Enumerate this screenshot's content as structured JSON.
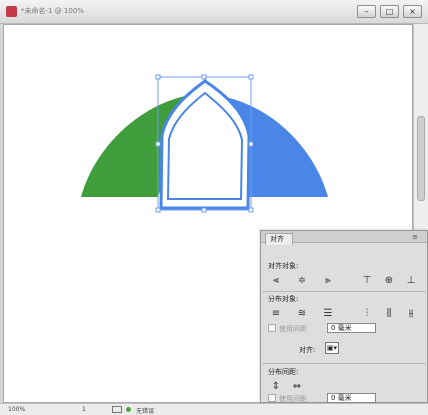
{
  "window": {
    "title": "*未命名-1 @ 100%",
    "minimize_label": "–",
    "restore_label": "□",
    "close_label": "×"
  },
  "status": {
    "zoom": "100%",
    "page": "1",
    "preflight": "无错误"
  },
  "panel": {
    "tab": "对齐",
    "close": "≡",
    "align_objects": "对齐对象:",
    "distribute_objects": "分布对象:",
    "use_spacing_1": "使用间距",
    "spacing_value_1": "0 毫米",
    "align_to_label": "对齐:",
    "distribute_spacing": "分布间距:",
    "use_spacing_2": "使用间距",
    "spacing_value_2": "0 毫米"
  },
  "colors": {
    "green_arc": "#3f9d3b",
    "blue_arc": "#4a86e8",
    "selection_blue": "#5b8fe6",
    "panel_bg": "#dedede"
  },
  "icons": {
    "app": "indesign-icon",
    "window_controls": [
      "minimize-icon",
      "restore-icon",
      "close-icon"
    ],
    "align_row": [
      "align-left-icon",
      "align-horizontal-center-icon",
      "align-right-icon",
      "align-top-icon",
      "align-vertical-center-icon",
      "align-bottom-icon"
    ],
    "distribute_row": [
      "distribute-top-icon",
      "distribute-vertical-center-icon",
      "distribute-bottom-icon",
      "distribute-left-icon",
      "distribute-horizontal-center-icon",
      "distribute-right-icon"
    ],
    "spacing_row": [
      "distribute-vertical-space-icon",
      "distribute-horizontal-space-icon"
    ]
  }
}
